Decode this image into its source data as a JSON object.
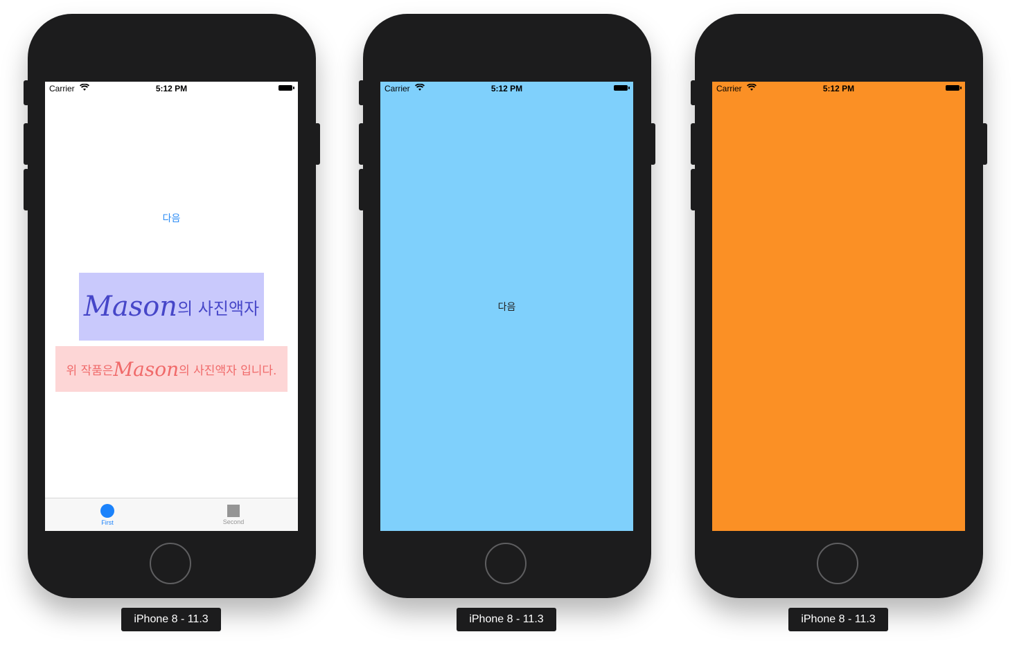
{
  "devices": [
    {
      "caption": "iPhone 8 - 11.3",
      "screen_color": "#ffffff",
      "status": {
        "carrier": "Carrier",
        "time": "5:12 PM"
      },
      "next_label": "다음",
      "next_color": "#2c8cf5",
      "title_script": "Mason",
      "title_korean": "의 사진액자",
      "subtitle_prefix": "위 작품은 ",
      "subtitle_script": "Mason",
      "subtitle_suffix": "의 사진액자 입니다.",
      "tabs": [
        {
          "label": "First",
          "icon": "circle-icon",
          "selected": true
        },
        {
          "label": "Second",
          "icon": "square-icon",
          "selected": false
        }
      ]
    },
    {
      "caption": "iPhone 8 - 11.3",
      "screen_color": "#7fd0fc",
      "status": {
        "carrier": "Carrier",
        "time": "5:12 PM"
      },
      "next_label": "다음",
      "next_color": "#222222"
    },
    {
      "caption": "iPhone 8 - 11.3",
      "screen_color": "#fb9025",
      "status": {
        "carrier": "Carrier",
        "time": "5:12 PM"
      }
    }
  ]
}
